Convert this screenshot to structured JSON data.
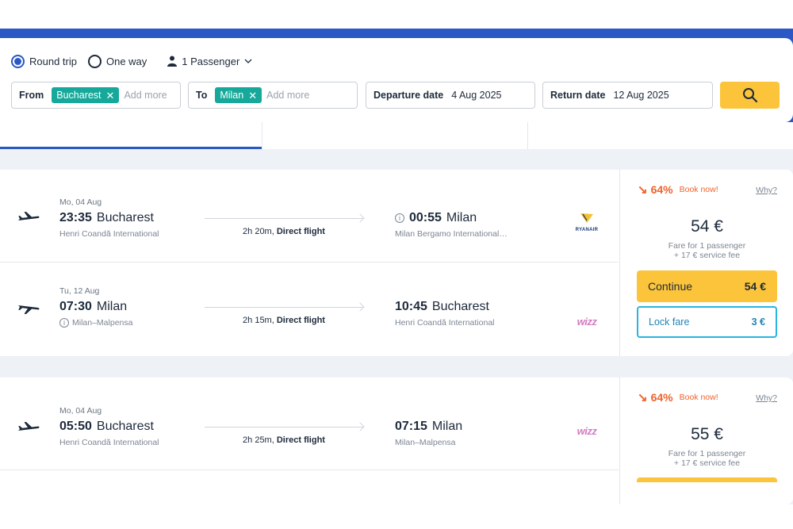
{
  "search": {
    "trip_types": [
      {
        "label": "Round trip",
        "selected": true
      },
      {
        "label": "One way",
        "selected": false
      }
    ],
    "passengers": "1 Passenger",
    "from": {
      "label": "From",
      "chip": "Bucharest",
      "add_more": "Add more"
    },
    "to": {
      "label": "To",
      "chip": "Milan",
      "add_more": "Add more"
    },
    "departure": {
      "label": "Departure date",
      "value": "4 Aug 2025"
    },
    "return": {
      "label": "Return date",
      "value": "12 Aug 2025"
    },
    "search_icon": "search-icon"
  },
  "results": [
    {
      "legs": [
        {
          "date": "Mo, 04 Aug",
          "dep_time": "23:35",
          "dep_city": "Bucharest",
          "dep_airport": "Henri Coandă International",
          "duration": "2h 20m, ",
          "stops": "Direct flight",
          "arr_time": "00:55",
          "arr_city": "Milan",
          "arr_airport": "Milan Bergamo International…",
          "airline": "RYANAIR"
        },
        {
          "date": "Tu, 12 Aug",
          "dep_time": "07:30",
          "dep_city": "Milan",
          "dep_airport": "Milan–Malpensa",
          "duration": "2h 15m, ",
          "stops": "Direct flight",
          "arr_time": "10:45",
          "arr_city": "Bucharest",
          "arr_airport": "Henri Coandă International",
          "airline": "wizz"
        }
      ],
      "deal_pct": "64%",
      "book_now": "Book now!",
      "why": "Why?",
      "price": "54 €",
      "fare_line1": "Fare for 1 passenger",
      "fare_line2": "+ 17 € service fee",
      "continue_label": "Continue",
      "continue_price": "54 €",
      "lock_label": "Lock fare",
      "lock_price": "3 €"
    },
    {
      "legs": [
        {
          "date": "Mo, 04 Aug",
          "dep_time": "05:50",
          "dep_city": "Bucharest",
          "dep_airport": "Henri Coandă International",
          "duration": "2h 25m, ",
          "stops": "Direct flight",
          "arr_time": "07:15",
          "arr_city": "Milan",
          "arr_airport": "Milan–Malpensa",
          "airline": "wizz"
        }
      ],
      "deal_pct": "64%",
      "book_now": "Book now!",
      "why": "Why?",
      "price": "55 €",
      "fare_line1": "Fare for 1 passenger",
      "fare_line2": "+ 17 € service fee"
    }
  ],
  "colors": {
    "brand_blue": "#2a58c4",
    "chip_teal": "#16a89a",
    "cta_yellow": "#fcc43a",
    "deal_orange": "#f0622b",
    "lock_blue": "#29b5e0"
  }
}
